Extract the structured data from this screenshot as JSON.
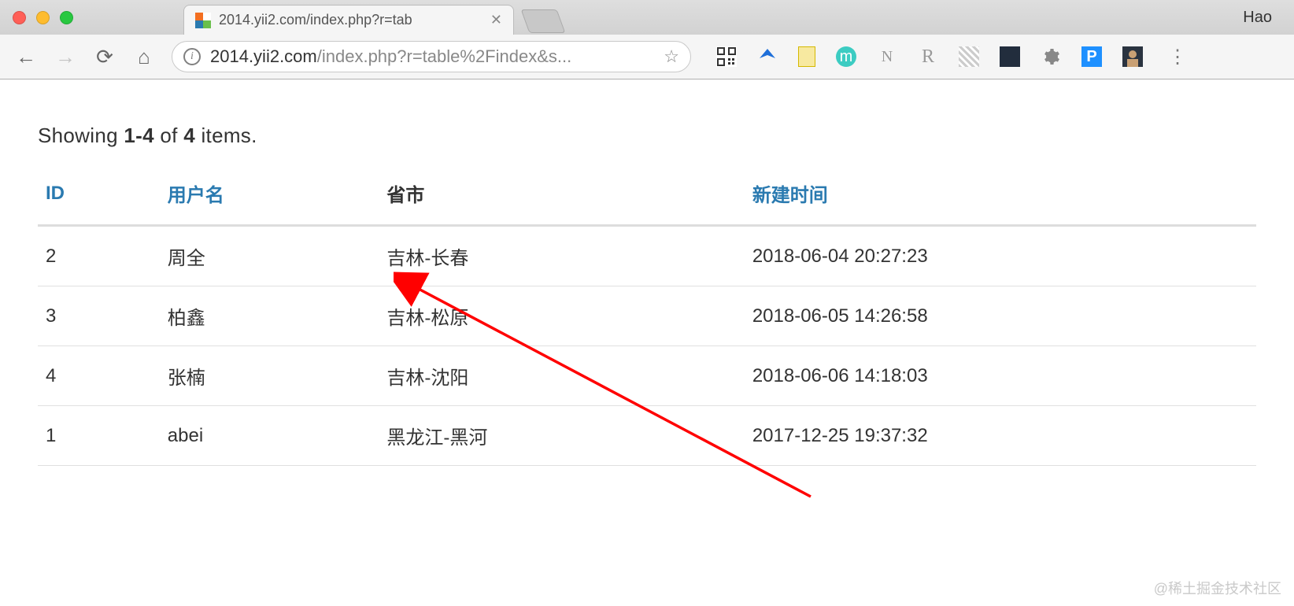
{
  "browser": {
    "traffic": [
      "red",
      "yellow",
      "green"
    ],
    "tab_title": "2014.yii2.com/index.php?r=tab",
    "profile": "Hao",
    "url_host": "2014.yii2.com",
    "url_path": "/index.php?r=table%2Findex&s...",
    "extensions": [
      "qr-icon",
      "y-icon",
      "note-icon",
      "m-icon",
      "n-icon",
      "r-icon",
      "stripes-icon",
      "dark-icon",
      "gear-icon",
      "p-icon",
      "avatar-icon"
    ]
  },
  "summary": {
    "prefix": "Showing ",
    "range": "1-4",
    "mid": " of ",
    "total": "4",
    "suffix": " items."
  },
  "table": {
    "headers": {
      "id": "ID",
      "username": "用户名",
      "province": "省市",
      "created": "新建时间"
    },
    "rows": [
      {
        "id": "2",
        "username": "周全",
        "province": "吉林-长春",
        "created": "2018-06-04 20:27:23"
      },
      {
        "id": "3",
        "username": "柏鑫",
        "province": "吉林-松原",
        "created": "2018-06-05 14:26:58"
      },
      {
        "id": "4",
        "username": "张楠",
        "province": "吉林-沈阳",
        "created": "2018-06-06 14:18:03"
      },
      {
        "id": "1",
        "username": "abei",
        "province": "黑龙江-黑河",
        "created": "2017-12-25 19:37:32"
      }
    ]
  },
  "watermark": "@稀土掘金技术社区"
}
